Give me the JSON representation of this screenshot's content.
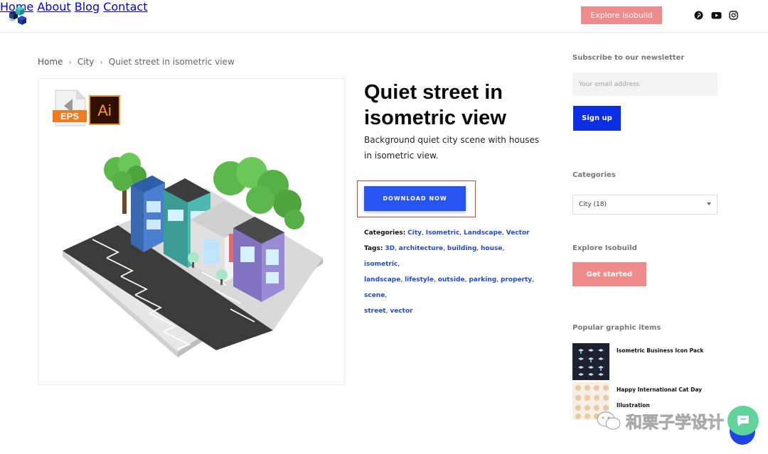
{
  "header": {
    "nav": [
      "Home",
      "About",
      "Blog",
      "Contact"
    ],
    "explore_label": "Explore Isobuild",
    "social_icons": [
      "pinterest-icon",
      "youtube-icon",
      "instagram-icon"
    ]
  },
  "breadcrumb": [
    "Home",
    "City",
    "Quiet street in isometric view"
  ],
  "preview": {
    "badges": [
      "EPS",
      "Ai"
    ]
  },
  "product": {
    "title": "Quiet street in isometric view",
    "description": "Background quiet city scene with houses in isometric view.",
    "download_label": "DOWNLOAD NOW",
    "categories_label": "Categories:",
    "categories": [
      "City",
      "Isometric",
      "Landscape",
      "Vector"
    ],
    "tags_label": "Tags:",
    "tags": [
      "3D",
      "architecture",
      "building",
      "house",
      "isometric",
      "landscape",
      "lifestyle",
      "outside",
      "parking",
      "property",
      "scene",
      "street",
      "vector"
    ]
  },
  "sidebar": {
    "newsletter_heading": "Subscribe to our newsletter",
    "email_placeholder": "Your email address",
    "signup_label": "Sign up",
    "categories_heading": "Categories",
    "category_selected": "City  (18)",
    "explore_heading": "Explore Isobuild",
    "get_started_label": "Get started",
    "popular_heading": "Popular graphic items",
    "popular": [
      {
        "title": "Isometric Business Icon Pack"
      },
      {
        "title": "Happy International Cat Day Illustration"
      }
    ]
  },
  "watermark": "和栗子学设计",
  "colors": {
    "accent_blue": "#2755f2",
    "pink": "#f08b8b",
    "link_blue": "#1f49e0"
  }
}
